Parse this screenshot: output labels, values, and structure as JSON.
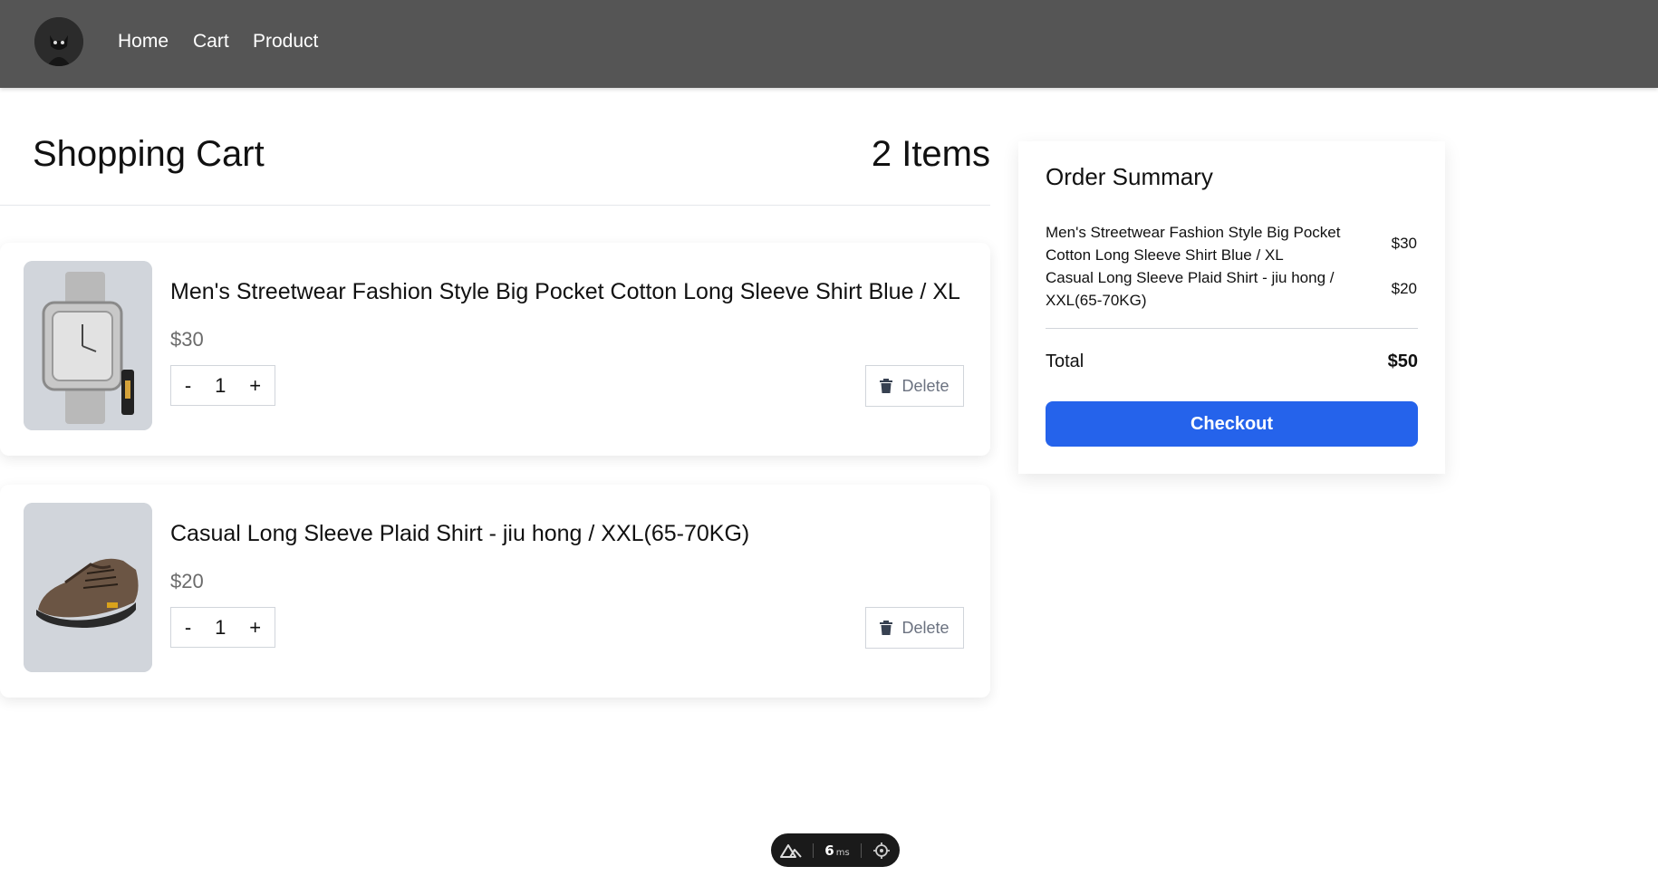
{
  "nav": {
    "links": [
      "Home",
      "Cart",
      "Product"
    ]
  },
  "cart": {
    "title": "Shopping Cart",
    "items_count": "2 Items",
    "items": [
      {
        "name": "Men's Streetwear Fashion Style Big Pocket Cotton Long Sleeve Shirt Blue / XL",
        "price": "$30",
        "quantity": "1",
        "minus": "-",
        "plus": "+",
        "delete_label": "Delete",
        "image": "watch-image"
      },
      {
        "name": "Casual Long Sleeve Plaid Shirt - jiu hong / XXL(65-70KG)",
        "price": "$20",
        "quantity": "1",
        "minus": "-",
        "plus": "+",
        "delete_label": "Delete",
        "image": "shoe-image"
      }
    ]
  },
  "summary": {
    "title": "Order Summary",
    "lines": [
      {
        "name": "Men's Streetwear Fashion Style Big Pocket Cotton Long Sleeve Shirt Blue / XL",
        "price": "$30"
      },
      {
        "name": "Casual Long Sleeve Plaid Shirt - jiu hong / XXL(65-70KG)",
        "price": "$20"
      }
    ],
    "total_label": "Total",
    "total_value": "$50",
    "checkout_label": "Checkout"
  },
  "devtools": {
    "time": "6",
    "unit": "ms"
  },
  "colors": {
    "nav_bg": "#555555",
    "accent": "#2563eb"
  }
}
